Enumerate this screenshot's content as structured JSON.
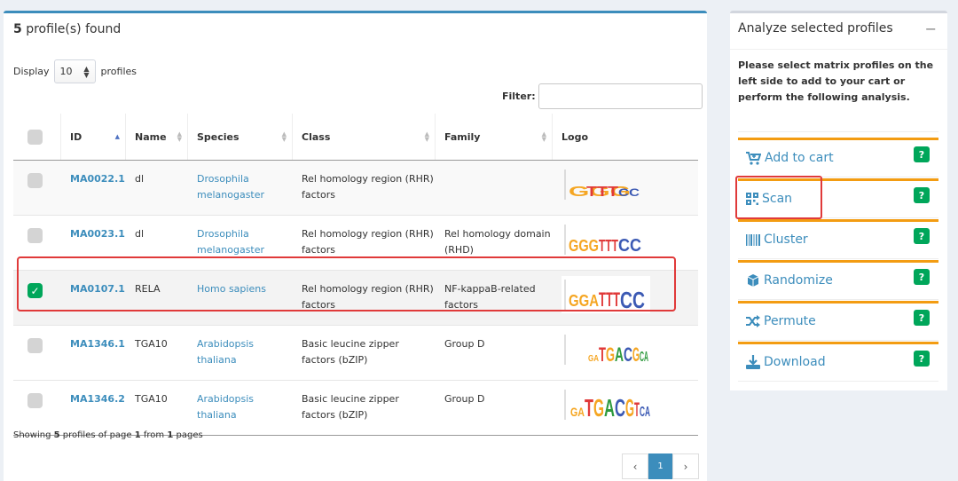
{
  "results": {
    "count": "5",
    "found_label": " profile(s) found",
    "display_prefix": "Display",
    "display_value": "10",
    "display_suffix": "profiles",
    "filter_label": "Filter:",
    "filter_value": ""
  },
  "table": {
    "headers": [
      "ID",
      "Name",
      "Species",
      "Class",
      "Family",
      "Logo"
    ],
    "rows": [
      {
        "checked": false,
        "id": "MA0022.1",
        "name": "dl",
        "species": "Drosophila melanogaster",
        "class": "Rel homology region (RHR) factors",
        "family": ""
      },
      {
        "checked": false,
        "id": "MA0023.1",
        "name": "dl",
        "species": "Drosophila melanogaster",
        "class": "Rel homology region (RHR) factors",
        "family": "Rel homology domain (RHD)"
      },
      {
        "checked": true,
        "id": "MA0107.1",
        "name": "RELA",
        "species": "Homo sapiens",
        "class": "Rel homology region (RHR) factors",
        "family": "NF-kappaB-related factors"
      },
      {
        "checked": false,
        "id": "MA1346.1",
        "name": "TGA10",
        "species": "Arabidopsis thaliana",
        "class": "Basic leucine zipper factors (bZIP)",
        "family": "Group D"
      },
      {
        "checked": false,
        "id": "MA1346.2",
        "name": "TGA10",
        "species": "Arabidopsis thaliana",
        "class": "Basic leucine zipper factors (bZIP)",
        "family": "Group D"
      }
    ]
  },
  "footer": {
    "showing_prefix": "Showing ",
    "showing_count": "5",
    "showing_mid": " profiles of page ",
    "page": "1",
    "showing_from": " from ",
    "pages": "1",
    "showing_suffix": " pages",
    "pager_prev": "‹",
    "pager_current": "1",
    "pager_next": "›"
  },
  "sidebar": {
    "title": "Analyze selected profiles",
    "collapse": "−",
    "description": "Please select matrix profiles on the left side to add to your cart or perform the following analysis.",
    "actions": [
      {
        "label": "Add to cart",
        "icon": "cart-icon"
      },
      {
        "label": "Scan",
        "icon": "scan-icon"
      },
      {
        "label": "Cluster",
        "icon": "barcode-icon"
      },
      {
        "label": "Randomize",
        "icon": "cube-icon"
      },
      {
        "label": "Permute",
        "icon": "shuffle-icon"
      },
      {
        "label": "Download",
        "icon": "download-icon"
      }
    ],
    "help_label": "?"
  },
  "colors": {
    "primary": "#3c8dbc",
    "accent": "#f39c12",
    "success": "#00a65a",
    "highlight": "#e03a3a"
  }
}
